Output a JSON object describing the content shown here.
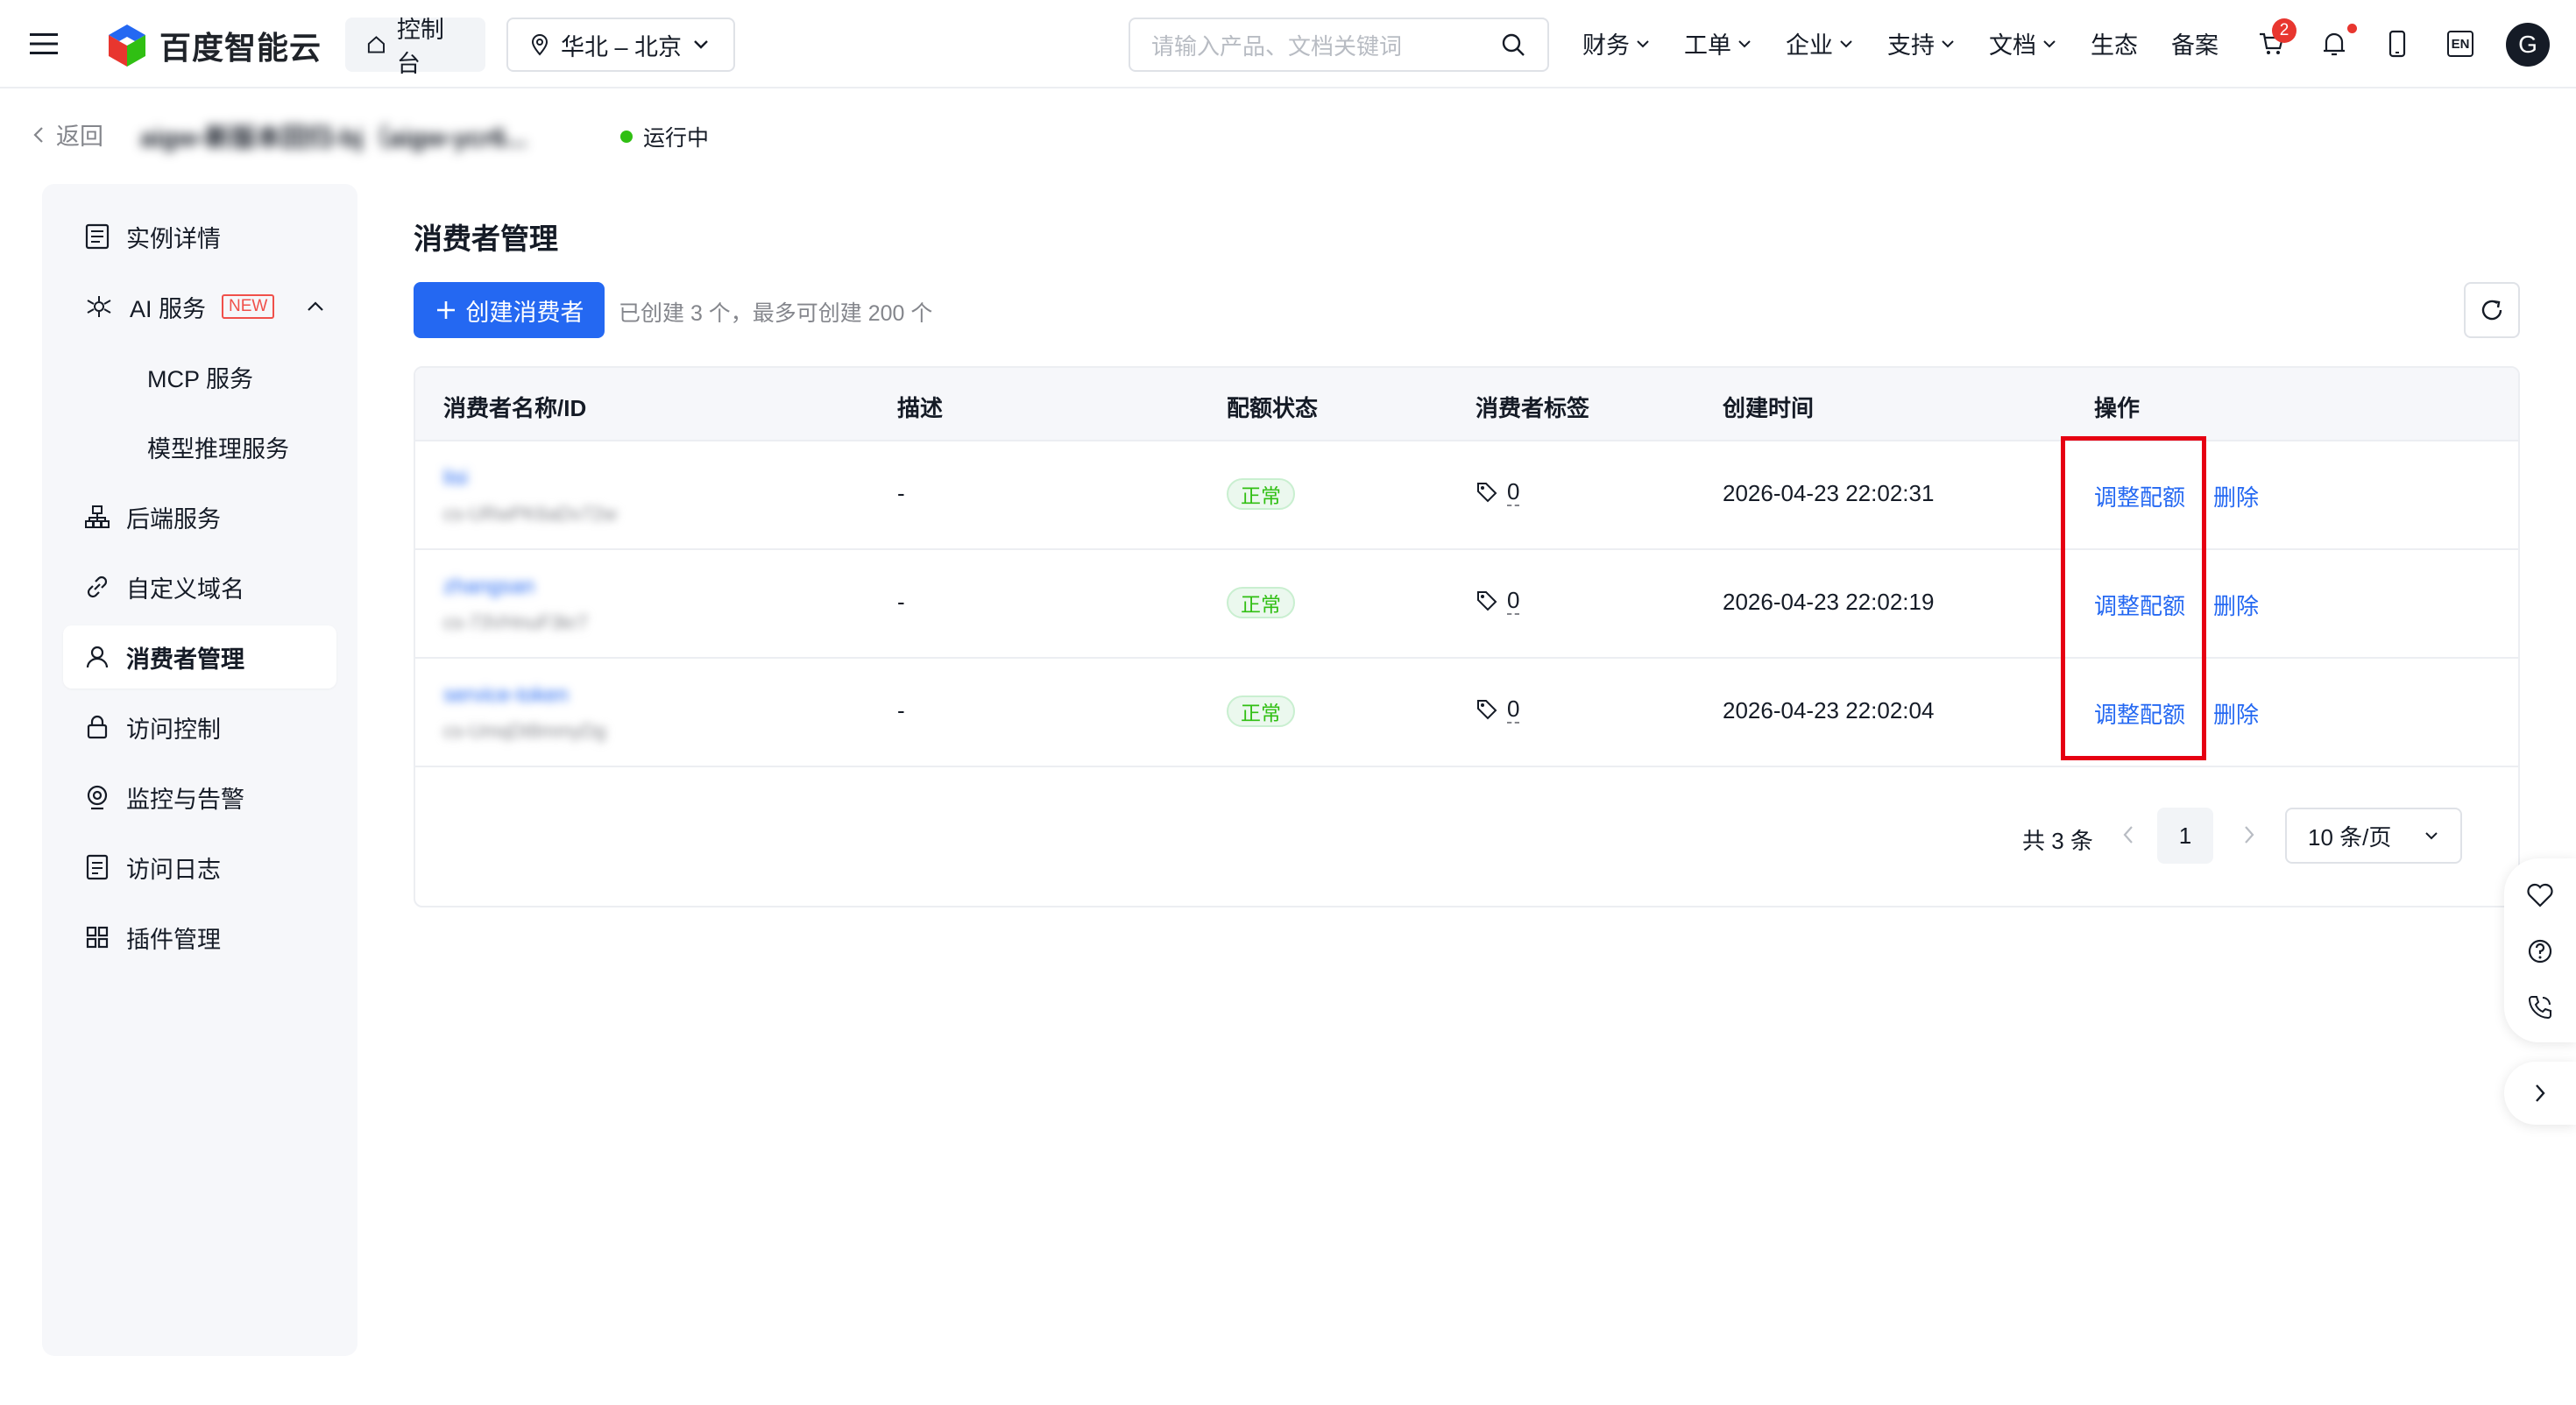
{
  "header": {
    "brand": "百度智能云",
    "console_label": "控制台",
    "region_label": "华北 – 北京",
    "search_placeholder": "请输入产品、文档关键词",
    "nav": [
      "财务",
      "工单",
      "企业",
      "支持",
      "文档",
      "生态",
      "备案"
    ],
    "cart_badge": "2",
    "lang_label": "EN",
    "avatar_initial": "G"
  },
  "breadcrumb": {
    "back_label": "返回",
    "instance_name": "aigw-新版本回归-bj（aigw-ycr6...",
    "status_label": "运行中"
  },
  "sidebar": {
    "items": [
      {
        "label": "实例详情",
        "icon": "list-icon"
      },
      {
        "label": "AI 服务",
        "icon": "ai-icon",
        "tag": "NEW"
      },
      {
        "label": "MCP 服务"
      },
      {
        "label": "模型推理服务"
      },
      {
        "label": "后端服务",
        "icon": "hierarchy-icon"
      },
      {
        "label": "自定义域名",
        "icon": "link-icon"
      },
      {
        "label": "消费者管理",
        "icon": "user-icon",
        "active": true
      },
      {
        "label": "访问控制",
        "icon": "lock-icon"
      },
      {
        "label": "监控与告警",
        "icon": "monitor-icon"
      },
      {
        "label": "访问日志",
        "icon": "log-icon"
      },
      {
        "label": "插件管理",
        "icon": "grid-icon"
      }
    ]
  },
  "main": {
    "title": "消费者管理",
    "create_label": "创建消费者",
    "hint": "已创建 3 个，最多可创建 200 个",
    "columns": [
      "消费者名称/ID",
      "描述",
      "配额状态",
      "消费者标签",
      "创建时间",
      "操作"
    ],
    "rows": [
      {
        "name": "lisi",
        "id": "cs-URwPK6aDv72w",
        "desc": "-",
        "quota": "正常",
        "tags": "0",
        "created": "2026-04-23 22:02:31",
        "action_adjust": "调整配额",
        "action_delete": "删除"
      },
      {
        "name": "zhangsan",
        "id": "cs-73VHnuF3kr7",
        "desc": "-",
        "quota": "正常",
        "tags": "0",
        "created": "2026-04-23 22:02:19",
        "action_adjust": "调整配额",
        "action_delete": "删除"
      },
      {
        "name": "service-token",
        "id": "cs-UmqDt8mmyDg",
        "desc": "-",
        "quota": "正常",
        "tags": "0",
        "created": "2026-04-23 22:02:04",
        "action_adjust": "调整配额",
        "action_delete": "删除"
      }
    ],
    "pagination": {
      "total": "共 3 条",
      "current": "1",
      "page_size": "10 条/页"
    }
  },
  "colors": {
    "primary": "#2468f2",
    "success": "#30bf13",
    "danger": "#e8362f",
    "highlight": "#e60012"
  }
}
